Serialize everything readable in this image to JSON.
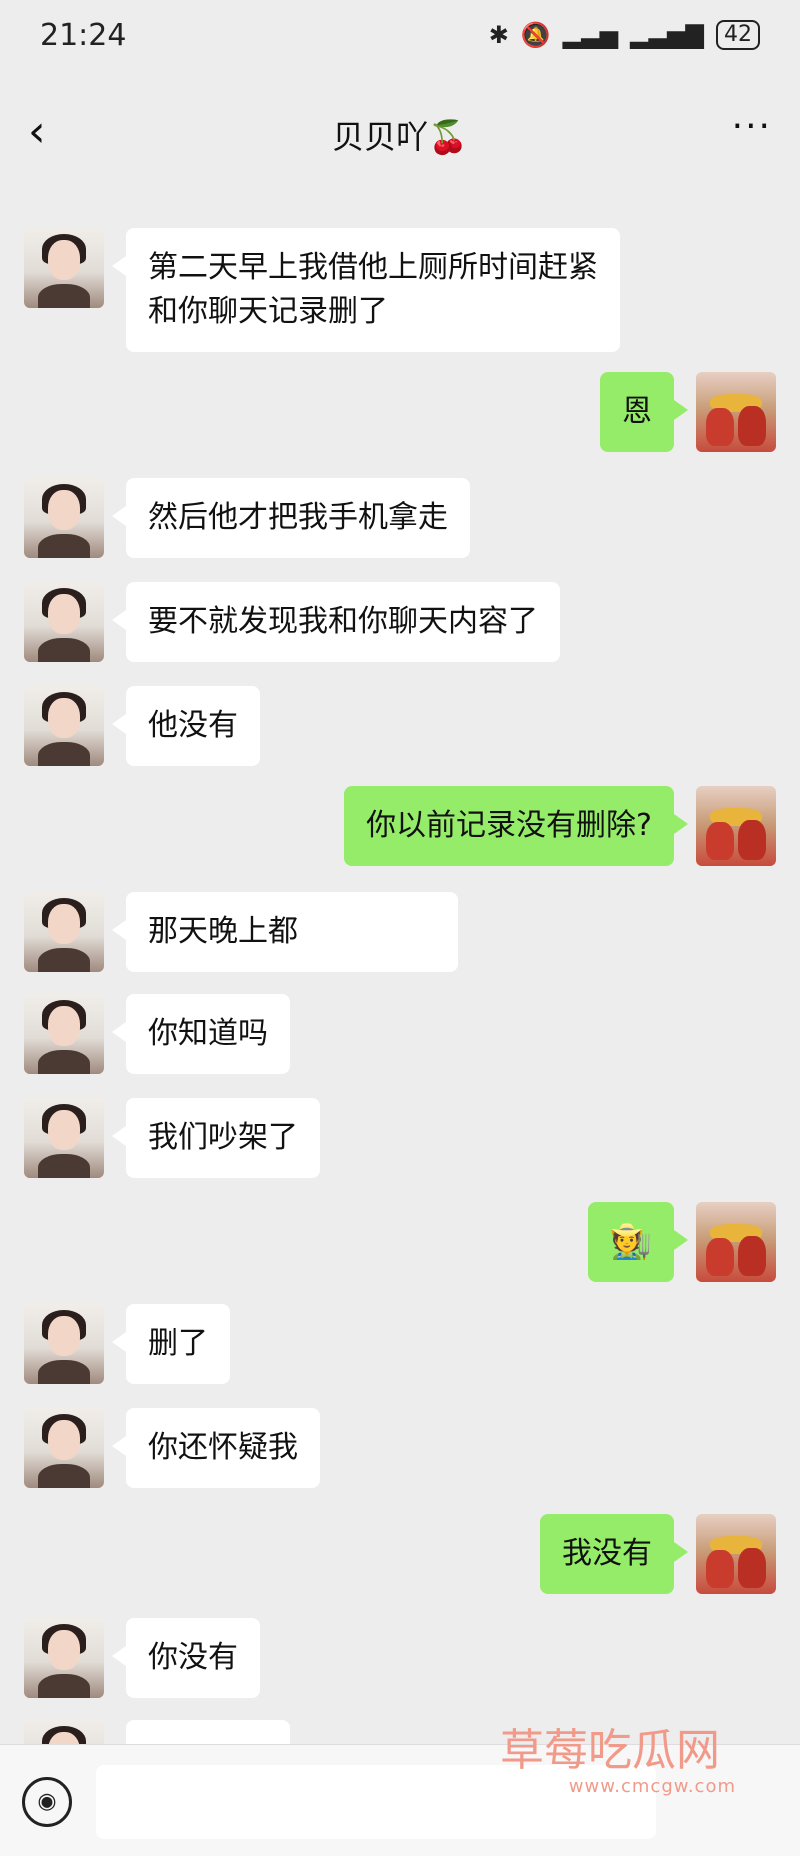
{
  "status_bar": {
    "time": "21:24",
    "battery": "42",
    "icons": [
      "bluetooth-icon",
      "mute-icon",
      "signal-icon",
      "signal-icon-2",
      "battery-icon"
    ]
  },
  "nav": {
    "title": "贝贝吖🍒",
    "back_icon": "chevron-left-icon",
    "more_icon": "more-icon"
  },
  "messages": [
    {
      "side": "left",
      "text": "第二天早上我借他上厕所时间赶紧\n和你聊天记录删了"
    },
    {
      "side": "right",
      "text": "恩"
    },
    {
      "side": "left",
      "text": "然后他才把我手机拿走"
    },
    {
      "side": "left",
      "text": "要不就发现我和你聊天内容了"
    },
    {
      "side": "left",
      "text": "他没有"
    },
    {
      "side": "right",
      "text": "你以前记录没有删除?"
    },
    {
      "side": "left",
      "text": "那天晚上都"
    },
    {
      "side": "left",
      "text": "你知道吗"
    },
    {
      "side": "left",
      "text": "我们吵架了"
    },
    {
      "side": "right",
      "text": "🧑‍🌾"
    },
    {
      "side": "left",
      "text": "删了"
    },
    {
      "side": "left",
      "text": "你还怀疑我"
    },
    {
      "side": "right",
      "text": "我没有"
    },
    {
      "side": "left",
      "text": "你没有"
    }
  ],
  "input": {
    "voice_icon": "voice-icon"
  },
  "watermark": {
    "title": "草莓吃瓜网",
    "url": "www.cmcgw.com"
  },
  "colors": {
    "background": "#ededed",
    "bubble_self": "#95ec69",
    "bubble_other": "#ffffff"
  }
}
